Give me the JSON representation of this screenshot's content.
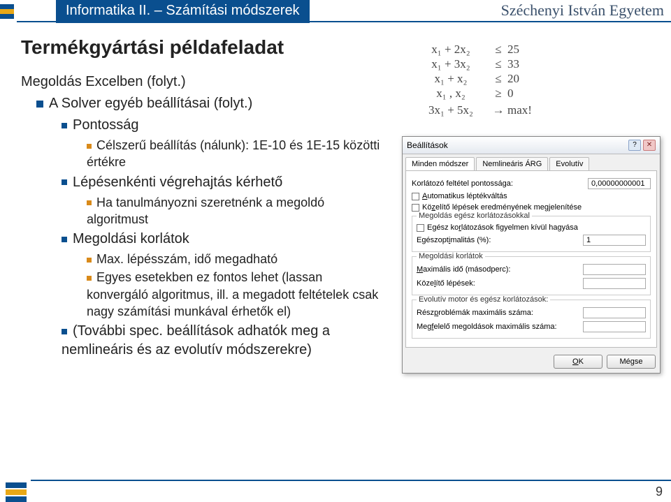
{
  "header": {
    "course": "Informatika II. – Számítási módszerek",
    "university": "Széchenyi István Egyetem"
  },
  "slide": {
    "title": "Termékgyártási példafeladat",
    "subtitle1": "Megoldás Excelben (folyt.)",
    "subtitle2": "A Solver egyéb beállításai (folyt.)",
    "b1": "Pontosság",
    "b1a": "Célszerű beállítás (nálunk): 1E-10 és 1E-15 közötti értékre",
    "b2": "Lépésenkénti végrehajtás kérhető",
    "b2a": "Ha tanulmányozni szeretnénk a megoldó algoritmust",
    "b3": "Megoldási korlátok",
    "b3a": "Max. lépésszám, idő megadható",
    "b3b": "Egyes esetekben ez fontos lehet (lassan konvergáló algoritmus, ill. a megadott feltételek csak nagy számítási munkával érhetők el)",
    "b4": "(További spec. beállítások adhatók meg a nemlineáris és az evolutív módszerekre)"
  },
  "equations": {
    "rows": [
      {
        "lhs": "x₁ + 2x₂",
        "op": "≤",
        "rhs": "25"
      },
      {
        "lhs": "x₁ + 3x₂",
        "op": "≤",
        "rhs": "33"
      },
      {
        "lhs": "x₁ + x₂",
        "op": "≤",
        "rhs": "20"
      },
      {
        "lhs": "x₁ , x₂",
        "op": "≥",
        "rhs": "0"
      },
      {
        "lhs": "3x₁ + 5x₂",
        "op": "→",
        "rhs": "max!"
      }
    ]
  },
  "dialog": {
    "title": "Beállítások",
    "tabs": [
      "Minden módszer",
      "Nemlineáris ÁRG",
      "Evolutív"
    ],
    "precision_label": "Korlátozó feltétel pontossága:",
    "precision_value": "0,00000000001",
    "auto_scale": "Automatikus léptékváltás",
    "show_iter": "Közelítő lépések eredményének megjelenítése",
    "fs_int_title": "Megoldás egész korlátozásokkal",
    "ignore_int": "Egész korlátozások figyelmen kívül hagyása",
    "int_opt_label": "Egészoptimalitás (%):",
    "int_opt_value": "1",
    "fs_limits_title": "Megoldási korlátok",
    "max_time": "Maximális idő (másodperc):",
    "iterations": "Közelítő lépések:",
    "fs_evo_title": "Evolutív motor és egész korlátozások:",
    "sub_max": "Részproblémák maximális száma:",
    "sol_max": "Megfelelő megoldások maximális száma:",
    "ok": "OK",
    "cancel": "Mégse"
  },
  "page_number": "9"
}
